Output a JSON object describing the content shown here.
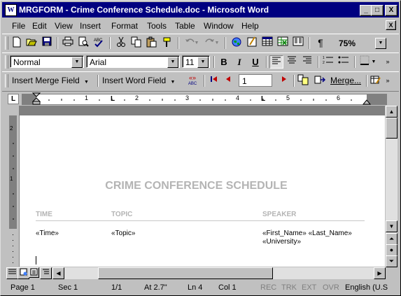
{
  "window": {
    "title": "MRGFORM - Crime Conference Schedule.doc - Microsoft Word",
    "app_icon_letter": "W",
    "min_glyph": "_",
    "max_glyph": "□",
    "close_glyph": "X"
  },
  "menu": {
    "items": [
      {
        "label": "File"
      },
      {
        "label": "Edit"
      },
      {
        "label": "View"
      },
      {
        "label": "Insert"
      },
      {
        "label": "Format"
      },
      {
        "label": "Tools"
      },
      {
        "label": "Table"
      },
      {
        "label": "Window"
      },
      {
        "label": "Help"
      }
    ],
    "doc_close_glyph": "X"
  },
  "standard_toolbar": {
    "zoom": "75%",
    "paragraph_glyph": "¶"
  },
  "format_toolbar": {
    "style": "Normal",
    "font": "Arial",
    "size": "11",
    "bold": "B",
    "italic": "I",
    "underline": "U"
  },
  "mailmerge_toolbar": {
    "insert_merge_field": "Insert Merge Field",
    "insert_word_field": "Insert Word Field",
    "abc_top": "«»",
    "abc_bottom": "ABC",
    "record_number": "1",
    "merge_label": "Merge..."
  },
  "ruler": {
    "numbers": [
      "1",
      "2",
      "3",
      "4",
      "5",
      "6"
    ],
    "tab_stop_glyph": "L"
  },
  "left_ruler": {
    "numbers": [
      "2",
      "1"
    ]
  },
  "document": {
    "heading": "CRIME CONFERENCE SCHEDULE",
    "columns": [
      "TIME",
      "TOPIC",
      "SPEAKER"
    ],
    "row": {
      "time": "«Time»",
      "topic": "«Topic»",
      "speaker_line1": "«First_Name» «Last_Name»",
      "speaker_line2": "«University»"
    }
  },
  "status": {
    "page": "Page 1",
    "section": "Sec 1",
    "pages": "1/1",
    "at": "At 2.7\"",
    "line": "Ln 4",
    "col": "Col 1",
    "rec": "REC",
    "trk": "TRK",
    "ext": "EXT",
    "ovr": "OVR",
    "language": "English (U.S"
  },
  "colors": {
    "titlebar": "#000080",
    "face": "#c0c0c0",
    "doc_grey_text": "#b4b4b4",
    "record_arrow": "#c00000"
  }
}
